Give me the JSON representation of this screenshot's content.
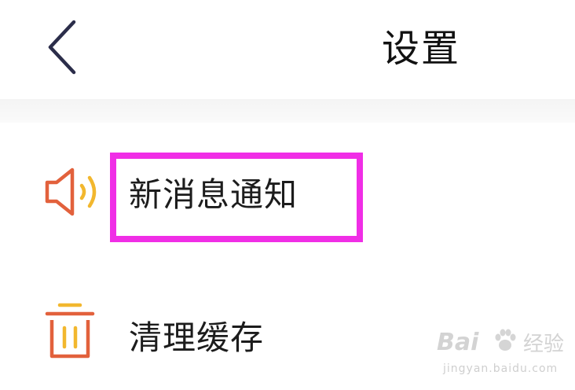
{
  "header": {
    "title": "设置",
    "back_icon": "chevron-left-icon"
  },
  "settings": {
    "items": [
      {
        "label": "新消息通知",
        "icon": "speaker-icon"
      },
      {
        "label": "清理缓存",
        "icon": "trash-icon"
      }
    ]
  },
  "annotation": {
    "highlight_color": "#f02ee6"
  },
  "colors": {
    "icon_primary": "#e2613c",
    "icon_accent": "#f2b72e",
    "back_arrow": "#2b2d4a"
  },
  "watermark": {
    "logo": "Bai",
    "name": "经验",
    "url": "jingyan.baidu.com"
  }
}
